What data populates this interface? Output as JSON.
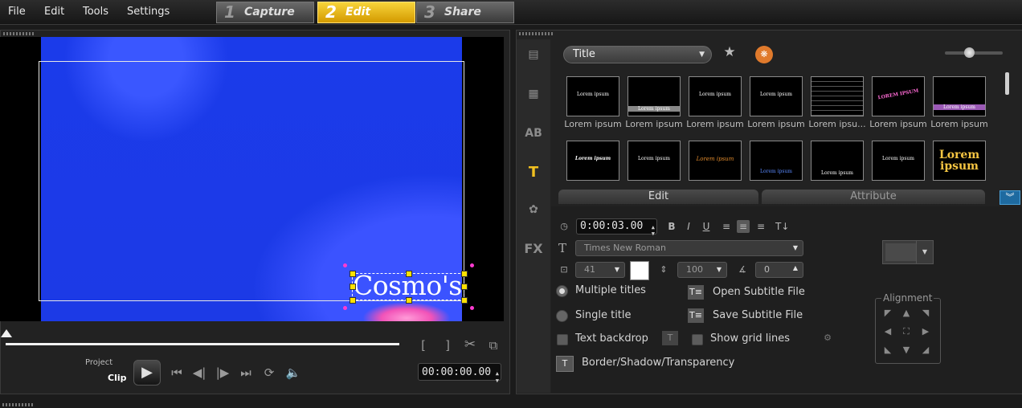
{
  "menu": {
    "file": "File",
    "edit": "Edit",
    "tools": "Tools",
    "settings": "Settings"
  },
  "steps": [
    {
      "num": "1",
      "label": "Capture"
    },
    {
      "num": "2",
      "label": "Edit"
    },
    {
      "num": "3",
      "label": "Share"
    }
  ],
  "preview": {
    "title_text": "Cosmo's",
    "project_label": "Project",
    "clip_label": "Clip",
    "timecode": "00:00:00.00",
    "controls": {
      "mark_in": "[",
      "mark_out": "]"
    }
  },
  "library": {
    "category": "Title",
    "row1_thumbs": [
      {
        "preview": "Lorem ipsum",
        "label": "Lorem ipsum"
      },
      {
        "preview": "Lorem ipsum",
        "label": "Lorem ipsum"
      },
      {
        "preview": "Lorem ipsum",
        "label": "Lorem ipsum"
      },
      {
        "preview": "Lorem ipsum",
        "label": "Lorem ipsum"
      },
      {
        "preview": "",
        "label": "Lorem ipsu..."
      },
      {
        "preview": "LOREM IPSUM",
        "label": "Lorem ipsum"
      },
      {
        "preview": "Lorem ipsum",
        "label": "Lorem ipsum"
      }
    ],
    "row2_thumbs": [
      {
        "preview": "Lorem ipsum"
      },
      {
        "preview": "Lorem ipsum"
      },
      {
        "preview": "Lorem ipsum"
      },
      {
        "preview": "Lorem ipsum"
      },
      {
        "preview": "Lorem ipsum"
      },
      {
        "preview": "Lorem ipsum"
      },
      {
        "preview": "Lorem ipsum"
      }
    ]
  },
  "tabs": {
    "edit": "Edit",
    "attribute": "Attribute"
  },
  "edit_panel": {
    "duration": "0:00:03.00",
    "font": "Times New Roman",
    "font_size": "41",
    "line_spacing": "100",
    "rotation": "0",
    "multiple_titles": "Multiple titles",
    "single_title": "Single title",
    "text_backdrop": "Text backdrop",
    "open_subtitle": "Open Subtitle File",
    "save_subtitle": "Save Subtitle File",
    "show_grid": "Show grid lines",
    "border_shadow": "Border/Shadow/Transparency",
    "alignment": "Alignment",
    "format_buttons": {
      "bold": "B",
      "italic": "I",
      "underline": "U"
    }
  },
  "side_tabs": {
    "fx": "FX"
  },
  "icons": [
    "media-icon",
    "instant-project-icon",
    "transition-icon",
    "title-icon",
    "graphic-icon",
    "filter-icon",
    "favorite-add-icon",
    "cookie-icon",
    "play-icon",
    "cut-icon"
  ],
  "colors": {
    "active_step": "#f0c020",
    "video_blue": "#1c3ae6",
    "handle": "#ffe100",
    "rotate_handle": "#ff3bd1"
  }
}
